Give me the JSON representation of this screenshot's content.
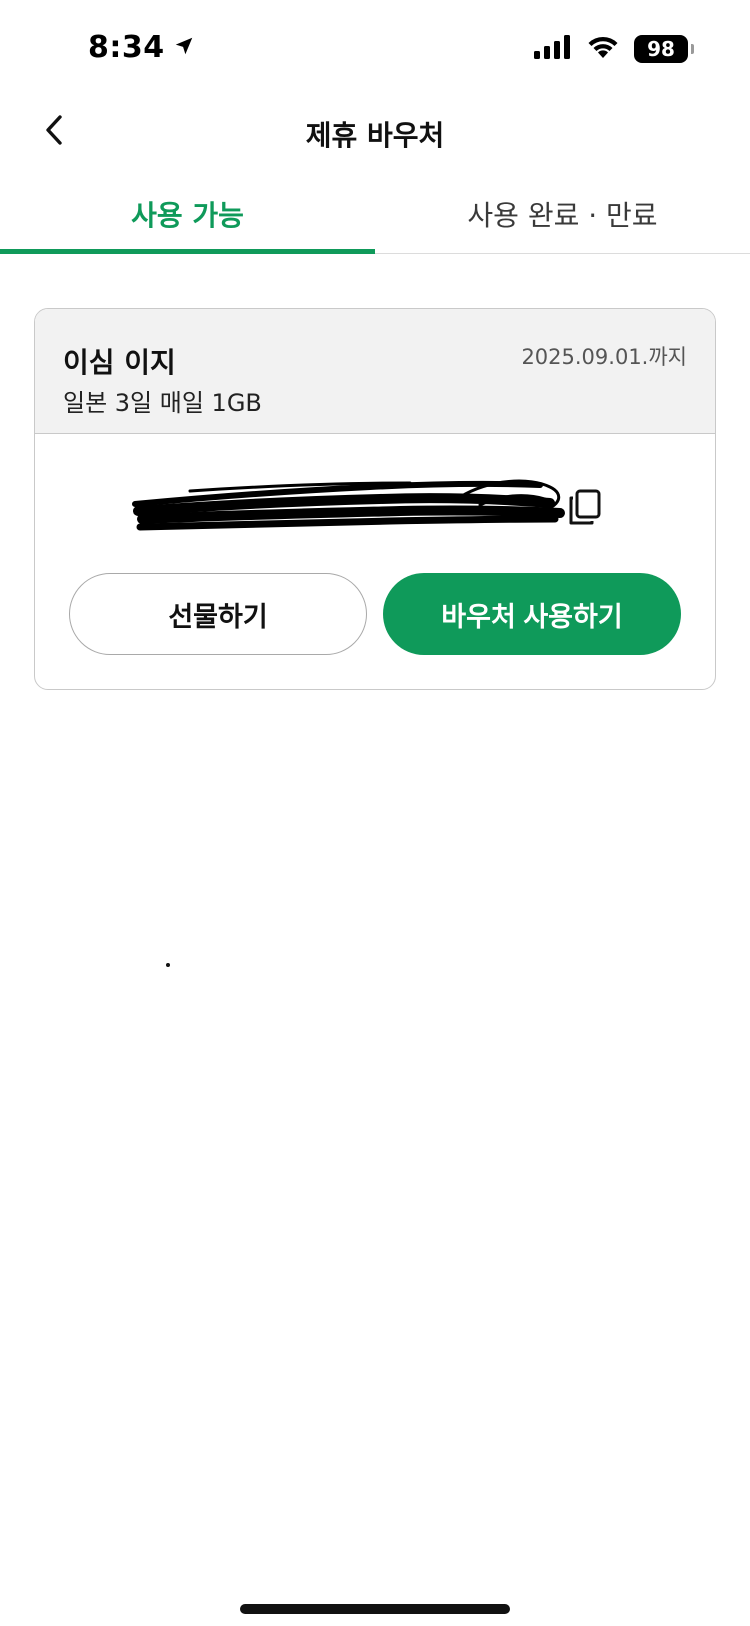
{
  "status_bar": {
    "time": "8:34",
    "battery": "98",
    "icons": [
      "location-arrow-icon",
      "cellular-signal-icon",
      "wifi-icon",
      "battery-icon"
    ]
  },
  "header": {
    "title": "제휴 바우처",
    "back_icon": "chevron-left-icon"
  },
  "tabs": [
    {
      "label": "사용 가능",
      "active": true
    },
    {
      "label": "사용 완료 · 만료",
      "active": false
    }
  ],
  "voucher": {
    "name": "이심 이지",
    "description": "일본 3일 매일 1GB",
    "expiry": "2025.09.01.까지",
    "copy_icon": "copy-icon",
    "gift_label": "선물하기",
    "use_label": "바우처 사용하기"
  },
  "colors": {
    "accent": "#0f9a5a",
    "card_header_bg": "#f2f2f2",
    "border": "#c9c9c9"
  }
}
